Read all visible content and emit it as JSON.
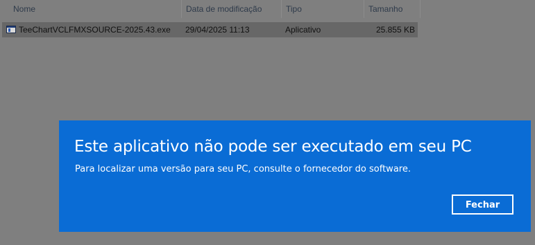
{
  "explorer": {
    "columns": {
      "name": "Nome",
      "date": "Data de modificação",
      "type": "Tipo",
      "size": "Tamanho"
    },
    "sort_icon": "chevron-up-icon",
    "files": [
      {
        "name": "TeeChartVCLFMXSOURCE-2025.43.exe",
        "date": "29/04/2025 11:13",
        "type": "Aplicativo",
        "size": "25.855 KB",
        "icon": "application-exe-icon"
      }
    ]
  },
  "dialog": {
    "title": "Este aplicativo não pode ser executado em seu PC",
    "message": "Para localizar uma versão para seu PC, consulte o fornecedor do software.",
    "close_label": "Fechar",
    "background_color": "#0a6cd5",
    "text_color": "#ffffff"
  }
}
